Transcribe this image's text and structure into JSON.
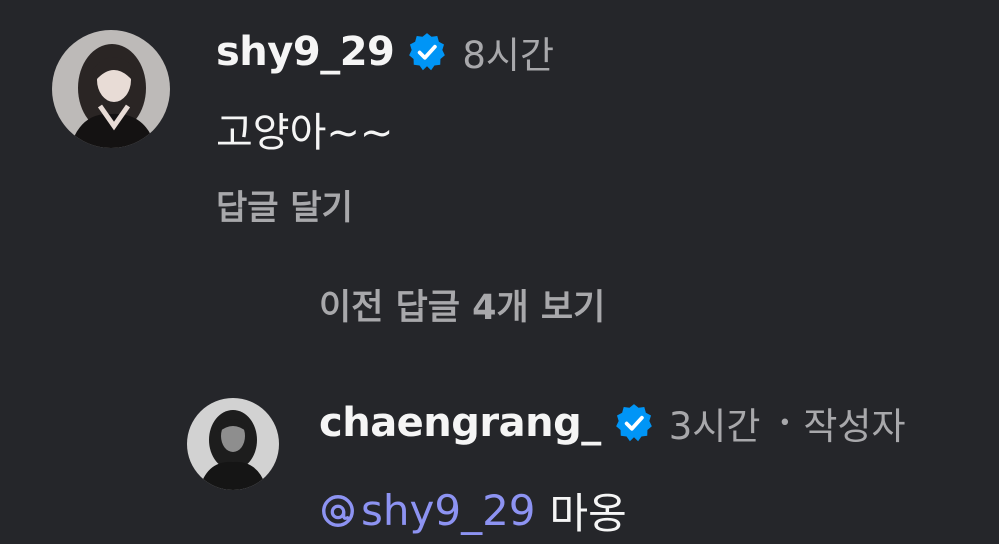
{
  "comment": {
    "username": "shy9_29",
    "timestamp": "8시간",
    "text": "고양아~~",
    "reply_action": "답글 달기",
    "view_replies": "이전 답글 4개 보기"
  },
  "reply": {
    "username": "chaengrang_",
    "timestamp": "3시간",
    "separator": "•",
    "author_tag": "작성자",
    "mention": "shy9_29",
    "text": "마옹"
  },
  "colors": {
    "background": "#25262a",
    "primary_text": "#f5f5f5",
    "secondary_text": "#a8a8ab",
    "verified_blue": "#0095f6",
    "mention": "#8d93f2"
  }
}
